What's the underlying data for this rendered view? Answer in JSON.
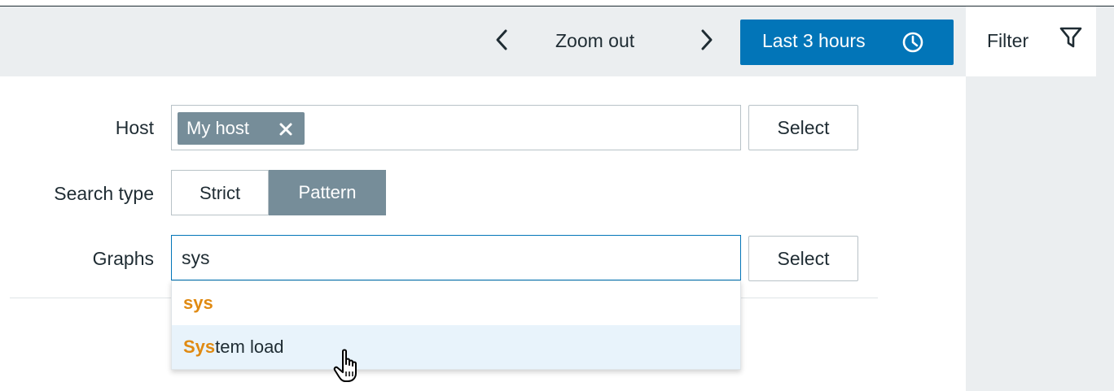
{
  "toolbar": {
    "zoom_out_label": "Zoom out",
    "time_range_label": "Last 3 hours",
    "filter_tab_label": "Filter"
  },
  "filter": {
    "host": {
      "label": "Host",
      "selected_chip": "My host",
      "select_label": "Select"
    },
    "search_type": {
      "label": "Search type",
      "options": [
        "Strict",
        "Pattern"
      ],
      "selected": "Pattern"
    },
    "graphs": {
      "label": "Graphs",
      "value": "sys",
      "select_label": "Select",
      "suggestions": [
        {
          "match": "sys",
          "rest": ""
        },
        {
          "match": "Sys",
          "rest": "tem load"
        }
      ]
    }
  },
  "colors": {
    "accent": "#0275b8",
    "chip": "#768d99",
    "highlight": "#e08a12",
    "toolbar_bg": "#ebeef0",
    "hover_row": "#e8f3fb"
  },
  "icons": {
    "prev": "chevron-left-icon",
    "next": "chevron-right-icon",
    "clock": "clock-icon",
    "filter": "funnel-icon",
    "remove": "close-icon",
    "cursor": "hand-pointer-icon"
  }
}
